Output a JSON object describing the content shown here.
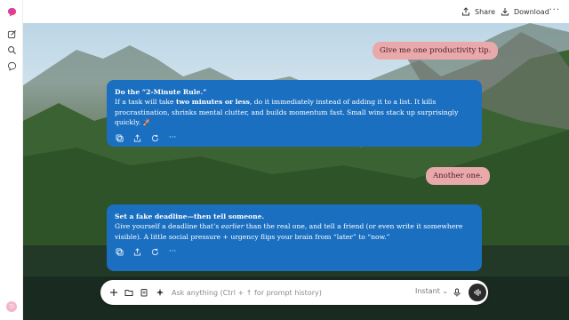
{
  "topbar": {
    "share_label": "Share",
    "download_label": "Download",
    "menu_label": "···"
  },
  "sidebar": {
    "avatar_initials": "TI"
  },
  "messages": [
    {
      "role": "user",
      "text": "Give me one productivity tip."
    },
    {
      "role": "assistant",
      "title": "Do the “2-Minute Rule.”",
      "body_pre": "If a task will take ",
      "body_bold": "two minutes or less",
      "body_post": ", do it immediately instead of adding it to a list. It kills procrastination, shrinks mental clutter, and builds momentum fast. Small wins stack up surprisingly quickly. 🚀"
    },
    {
      "role": "user",
      "text": "Another one."
    },
    {
      "role": "assistant",
      "title": "Set a fake deadline—then tell someone.",
      "body_pre": "Give yourself a deadline that’s ",
      "body_em": "earlier",
      "body_post": " than the real one, and tell a friend (or even write it somewhere visible). A little social pressure + urgency flips your brain from “later” to “now.”"
    }
  ],
  "composer": {
    "placeholder": "Ask anything (Ctrl + ↑ for prompt history)",
    "mode_label": "Instant ⌄"
  },
  "colors": {
    "assistant_bubble": "#1a6fc1",
    "user_bubble": "#e9a9aa",
    "logo": "#e83d84"
  }
}
